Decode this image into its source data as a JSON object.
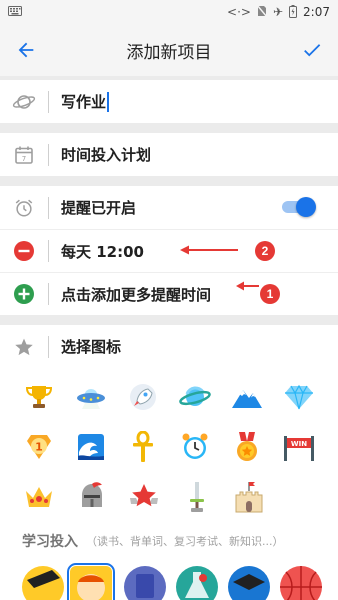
{
  "status_bar": {
    "left_icon": "keyboard-icon",
    "icons": [
      "link-icon",
      "no-sim-icon",
      "airplane-icon",
      "battery-icon"
    ],
    "time": "2:07"
  },
  "app_bar": {
    "back_icon": "arrow-back-icon",
    "title": "添加新项目",
    "confirm_icon": "check-icon",
    "accent": "#1a73e8"
  },
  "form": {
    "name_value": "写作业",
    "plan_label": "时间投入计划",
    "reminder_label": "提醒已开启",
    "reminder_on": true,
    "reminder_time": "每天 12:00",
    "add_reminder_label": "点击添加更多提醒时间",
    "choose_icon_label": "选择图标"
  },
  "annotations": {
    "badge1": "1",
    "badge2": "2",
    "color": "#e53935"
  },
  "icon_choices": [
    [
      "trophy-icon",
      "ufo-icon",
      "rocket-icon",
      "planet-icon",
      "mountain-icon",
      "diamond-icon"
    ],
    [
      "medal-1-icon",
      "wave-icon",
      "ankh-icon",
      "alarm-clock-icon",
      "medal-icon",
      "win-finish-icon"
    ],
    [
      "crown-icon",
      "knight-helmet-icon",
      "star-badge-icon",
      "sword-icon",
      "castle-icon"
    ]
  ],
  "category": {
    "title": "学习投入",
    "subtitle": "（读书、背单词、复习考试、新知识...）"
  }
}
